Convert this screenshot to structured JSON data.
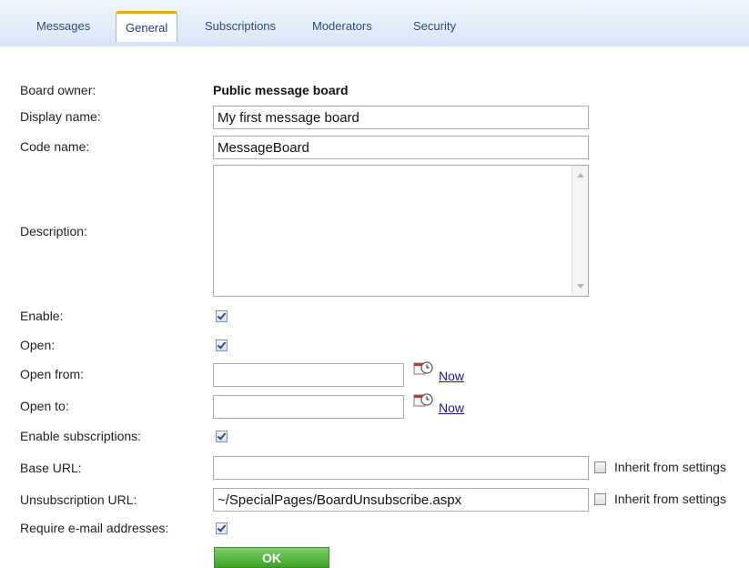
{
  "tabs": [
    {
      "label": "Messages",
      "active": false
    },
    {
      "label": "General",
      "active": true
    },
    {
      "label": "Subscriptions",
      "active": false
    },
    {
      "label": "Moderators",
      "active": false
    },
    {
      "label": "Security",
      "active": false
    }
  ],
  "form": {
    "board_owner": {
      "label": "Board owner:",
      "value": "Public message board"
    },
    "display_name": {
      "label": "Display name:",
      "value": "My first message board"
    },
    "code_name": {
      "label": "Code name:",
      "value": "MessageBoard"
    },
    "description": {
      "label": "Description:",
      "value": ""
    },
    "enable": {
      "label": "Enable:",
      "checked": true
    },
    "open": {
      "label": "Open:",
      "checked": true
    },
    "open_from": {
      "label": "Open from:",
      "value": "",
      "now_label": "Now"
    },
    "open_to": {
      "label": "Open to:",
      "value": "",
      "now_label": "Now"
    },
    "enable_subscriptions": {
      "label": "Enable subscriptions:",
      "checked": true
    },
    "base_url": {
      "label": "Base URL:",
      "value": "",
      "inherit_label": "Inherit from settings",
      "inherit_checked": false
    },
    "unsubscription_url": {
      "label": "Unsubscription URL:",
      "value": "~/SpecialPages/BoardUnsubscribe.aspx",
      "inherit_label": "Inherit from settings",
      "inherit_checked": false
    },
    "require_email": {
      "label": "Require e-mail addresses:",
      "checked": true
    },
    "ok_label": "OK"
  },
  "colors": {
    "tab_active_accent": "#f2a51a",
    "ok_button": "#3aa324",
    "link": "#1a1a8a"
  }
}
